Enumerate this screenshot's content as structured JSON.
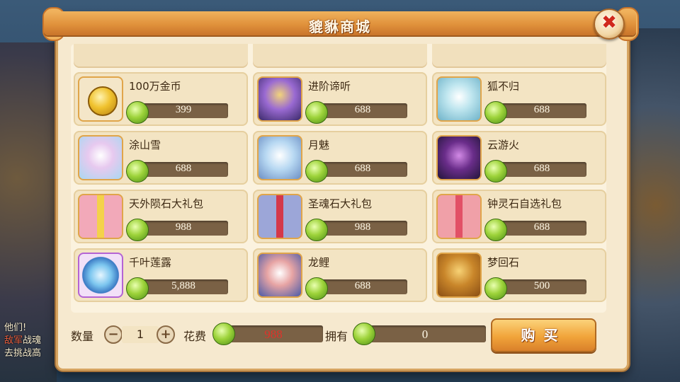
{
  "shop": {
    "title": "貔貅商城",
    "close_label": "✖",
    "items": [
      {
        "name": "100万金币",
        "price": "399",
        "icon": "gold-coin-icon"
      },
      {
        "name": "进阶谛听",
        "price": "688",
        "icon": "ditin-pet-icon"
      },
      {
        "name": "狐不归",
        "price": "688",
        "icon": "hubugui-pet-icon"
      },
      {
        "name": "涂山雪",
        "price": "688",
        "icon": "tushanxue-pet-icon"
      },
      {
        "name": "月魅",
        "price": "688",
        "icon": "yuemei-pet-icon"
      },
      {
        "name": "云游火",
        "price": "688",
        "icon": "yunyouhuo-pet-icon"
      },
      {
        "name": "天外陨石大礼包",
        "price": "988",
        "icon": "gift-box-yellow-icon"
      },
      {
        "name": "圣魂石大礼包",
        "price": "988",
        "icon": "gift-box-blue-icon"
      },
      {
        "name": "钟灵石自选礼包",
        "price": "688",
        "icon": "gift-box-pink-icon"
      },
      {
        "name": "千叶莲露",
        "price": "5,888",
        "icon": "lotus-dew-icon"
      },
      {
        "name": "龙鲤",
        "price": "688",
        "icon": "longli-pet-icon"
      },
      {
        "name": "梦回石",
        "price": "500",
        "icon": "dream-seal-icon"
      }
    ]
  },
  "footer": {
    "quantity_label": "数量",
    "quantity_value": "1",
    "minus_label": "−",
    "plus_label": "+",
    "cost_label": "花费",
    "cost_value": "988",
    "owned_label": "拥有",
    "owned_value": "0",
    "buy_label": "购买"
  },
  "background_chat": {
    "line1": "他们!",
    "line2_red": "敌军",
    "line2": "战魂",
    "line3": "去挑战高"
  },
  "colors": {
    "panel": "#f6e9cf",
    "titlebar": "#e0913b",
    "price_bar": "#7a6145",
    "cost_text": "#e0322a",
    "currency": "#9dd33a"
  }
}
